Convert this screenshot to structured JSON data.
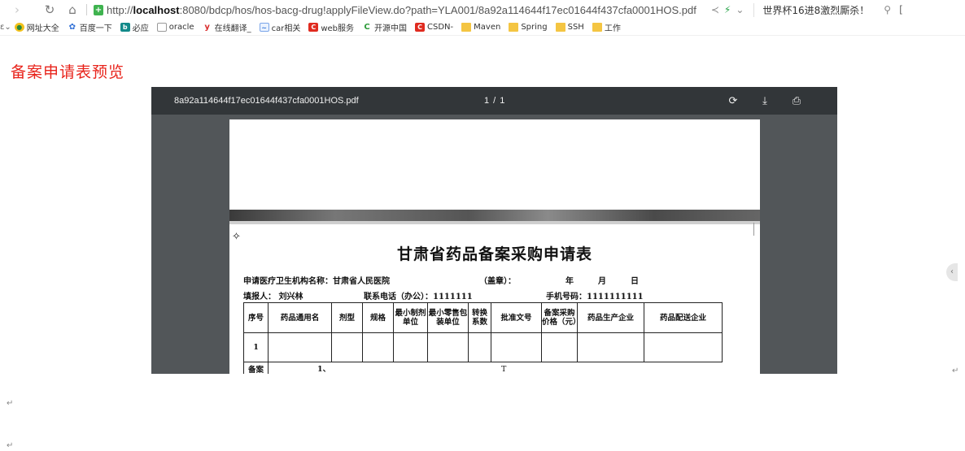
{
  "browser": {
    "url_prefix": "http://",
    "url_host": "localhost",
    "url_rest": ":8080/bdcp/hos/hos-bacg-drug!applyFileView.do?path=YLA001/8a92a114644f17ec01644f437cfa0001HOS.pdf",
    "hot_search": "世界杯16进8激烈厮杀！"
  },
  "bookmarks": [
    {
      "label": "网址大全",
      "icon": "globe-icon"
    },
    {
      "label": "百度一下",
      "icon": "paw-icon"
    },
    {
      "label": "必应",
      "icon": "bing-icon"
    },
    {
      "label": "oracle",
      "icon": "page-icon"
    },
    {
      "label": "在线翻译_",
      "icon": "y-icon"
    },
    {
      "label": "car相关",
      "icon": "car-icon"
    },
    {
      "label": "web服务",
      "icon": "csdn-icon"
    },
    {
      "label": "开源中国",
      "icon": "oschina-icon"
    },
    {
      "label": "CSDN-",
      "icon": "csdn-icon"
    },
    {
      "label": "Maven",
      "icon": "folder-icon"
    },
    {
      "label": "Spring",
      "icon": "folder-icon"
    },
    {
      "label": "SSH",
      "icon": "folder-icon"
    },
    {
      "label": "工作",
      "icon": "folder-icon"
    }
  ],
  "page": {
    "heading": "备案申请表预览"
  },
  "viewer": {
    "file_name": "8a92a114644f17ec01644f437cfa0001HOS.pdf",
    "page_indicator": "1 / 1"
  },
  "document": {
    "title": "甘肃省药品备案采购申请表",
    "line1": {
      "institution": "申请医疗卫生机构名称：甘肃省人民医院",
      "seal": "（盖章）：",
      "year": "年",
      "month": "月",
      "day": "日"
    },
    "line2": {
      "filler": "填报人：  刘兴林",
      "phone": "联系电话（办公）：1111111",
      "mobile": "手机号码：1111111111"
    },
    "table": {
      "headers": [
        "序号",
        "药品通用名",
        "剂型",
        "规格",
        "最小制剂单位",
        "最小零售包装单位",
        "转换系数",
        "批准文号",
        "备案采购价格（元）",
        "药品生产企业",
        "药品配送企业"
      ],
      "rows": [
        [
          "1",
          "",
          "",
          "",
          "",
          "",
          "",
          "",
          "",
          "",
          ""
        ]
      ],
      "remark_label": "备案",
      "remark_text": "1、",
      "remark_mark": "T"
    }
  },
  "colors": {
    "heading": "#e8231b",
    "viewer_bg": "#525659",
    "toolbar_bg": "#323639"
  }
}
